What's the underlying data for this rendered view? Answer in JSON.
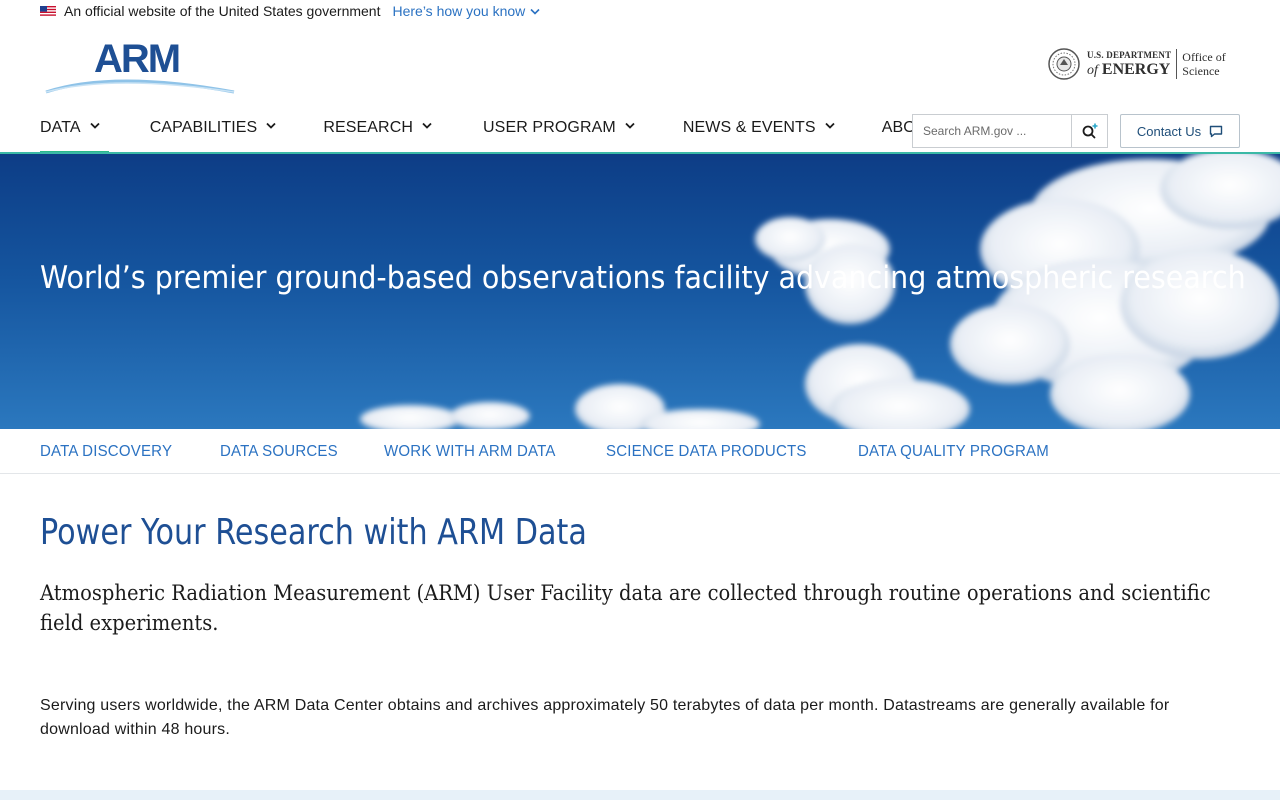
{
  "gov_banner": {
    "text": "An official website of the United States government",
    "link": "Here’s how you know"
  },
  "logo": {
    "text": "ARM"
  },
  "doe": {
    "line1": "U.S. DEPARTMENT",
    "of": "of",
    "line2": "ENERGY",
    "office_line1": "Office of",
    "office_line2": "Science"
  },
  "nav": {
    "items": [
      {
        "label": "DATA",
        "active": true
      },
      {
        "label": "CAPABILITIES"
      },
      {
        "label": "RESEARCH"
      },
      {
        "label": "USER PROGRAM"
      },
      {
        "label": "NEWS & EVENTS"
      },
      {
        "label": "ABOUT"
      }
    ],
    "search_placeholder": "Search ARM.gov ...",
    "contact_label": "Contact Us"
  },
  "hero": {
    "title": "World’s premier ground-based observations facility advancing atmospheric research"
  },
  "subnav": {
    "items": [
      "DATA DISCOVERY",
      "DATA SOURCES",
      "WORK WITH ARM DATA",
      "SCIENCE DATA PRODUCTS",
      "DATA QUALITY PROGRAM"
    ]
  },
  "content": {
    "title": "Power Your Research with ARM Data",
    "lead": "Atmospheric Radiation Measurement (ARM) User Facility data are collected through routine operations and scientific field experiments.",
    "body": "Serving users worldwide, the ARM Data Center obtains and archives approximately 50 terabytes of data per month. Datastreams are generally available for download within 48 hours."
  },
  "colors": {
    "accent_green": "#2ab98a",
    "link_blue": "#2b72c2",
    "title_blue": "#1e4f94",
    "hero_blue": "#15559f"
  }
}
